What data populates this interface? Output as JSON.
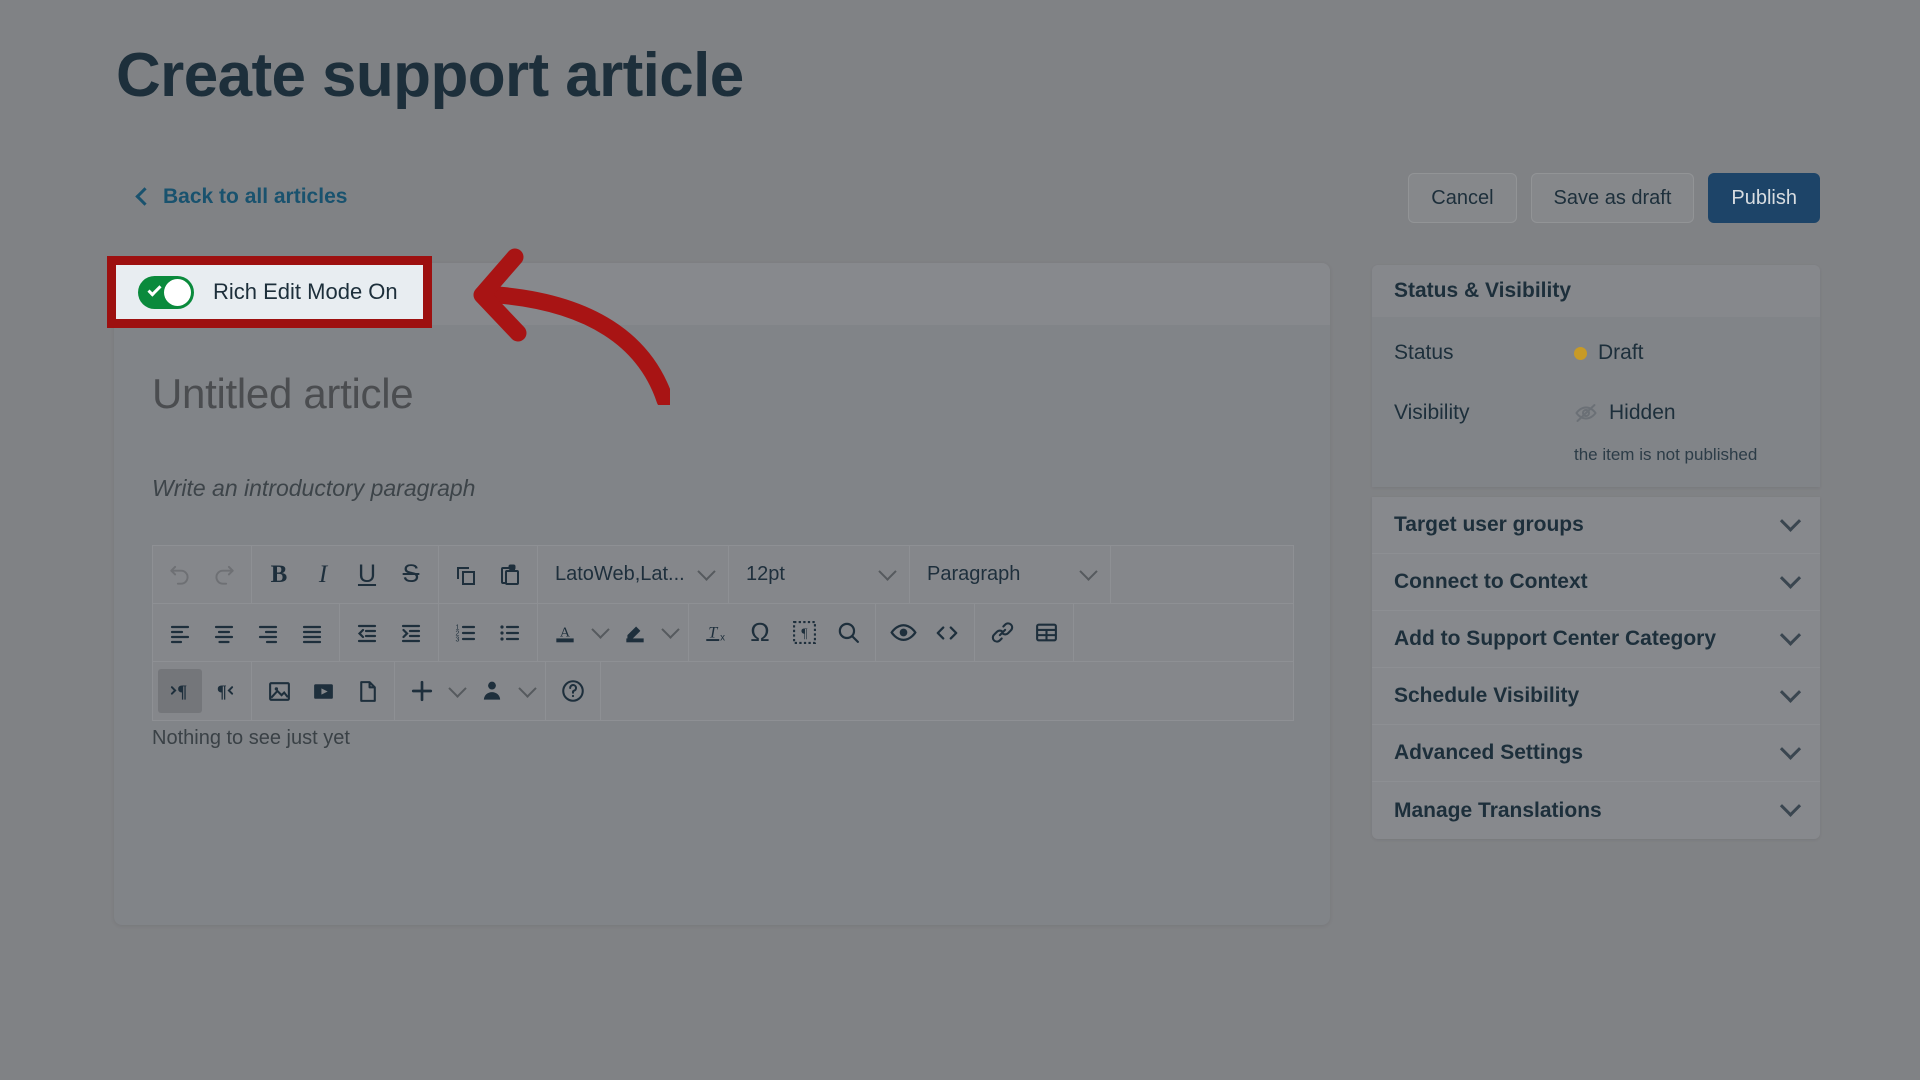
{
  "header": {
    "title": "Create support article",
    "back_link": "Back to all articles",
    "back_icon": "chevron-left-icon"
  },
  "actions": {
    "cancel": "Cancel",
    "save_draft": "Save as draft",
    "publish": "Publish",
    "publish_color": "#1d4468"
  },
  "highlight": {
    "toggle_label": "Rich Edit Mode On",
    "toggle_state": "on",
    "toggle_on_color": "#0a8a3c",
    "box_border_color": "#9d1010",
    "arrow_color": "#a81414",
    "arrow_icon": "curved-left-arrow-icon"
  },
  "editor": {
    "doc_title": "Untitled article",
    "intro_placeholder": "Write an introductory paragraph",
    "empty_state": "Nothing to see just yet",
    "selects": {
      "font_family": "LatoWeb,Lat...",
      "font_size": "12pt",
      "block_format": "Paragraph"
    },
    "toolbar_rows": [
      {
        "groups": [
          {
            "buttons": [
              {
                "name": "undo-icon",
                "title": "Undo",
                "disabled": true
              },
              {
                "name": "redo-icon",
                "title": "Redo",
                "disabled": true
              }
            ]
          },
          {
            "buttons": [
              {
                "name": "bold-icon",
                "title": "Bold"
              },
              {
                "name": "italic-icon",
                "title": "Italic"
              },
              {
                "name": "underline-icon",
                "title": "Underline"
              },
              {
                "name": "strikethrough-icon",
                "title": "Strikethrough"
              }
            ]
          },
          {
            "buttons": [
              {
                "name": "copy-icon",
                "title": "Copy"
              },
              {
                "name": "paste-icon",
                "title": "Paste"
              }
            ]
          }
        ]
      },
      {
        "groups": [
          {
            "buttons": [
              {
                "name": "align-left-icon",
                "title": "Align left"
              },
              {
                "name": "align-center-icon",
                "title": "Align center"
              },
              {
                "name": "align-right-icon",
                "title": "Align right"
              },
              {
                "name": "align-justify-icon",
                "title": "Justify"
              }
            ]
          },
          {
            "buttons": [
              {
                "name": "outdent-icon",
                "title": "Decrease indent"
              },
              {
                "name": "indent-icon",
                "title": "Increase indent"
              }
            ]
          },
          {
            "buttons": [
              {
                "name": "numbered-list-icon",
                "title": "Numbered list"
              },
              {
                "name": "bullet-list-icon",
                "title": "Bullet list"
              }
            ]
          },
          {
            "buttons": [
              {
                "name": "text-color-icon",
                "title": "Text color",
                "split": true
              },
              {
                "name": "highlight-color-icon",
                "title": "Background color",
                "split": true
              }
            ]
          },
          {
            "buttons": [
              {
                "name": "clear-formatting-icon",
                "title": "Clear formatting"
              },
              {
                "name": "special-character-icon",
                "title": "Special character"
              },
              {
                "name": "show-blocks-icon",
                "title": "Show blocks"
              },
              {
                "name": "search-icon",
                "title": "Find and replace"
              }
            ]
          },
          {
            "buttons": [
              {
                "name": "preview-icon",
                "title": "Preview"
              },
              {
                "name": "source-code-icon",
                "title": "Source code"
              }
            ]
          },
          {
            "buttons": [
              {
                "name": "link-icon",
                "title": "Insert link"
              },
              {
                "name": "table-icon",
                "title": "Table"
              }
            ]
          }
        ]
      },
      {
        "groups": [
          {
            "buttons": [
              {
                "name": "ltr-direction-icon",
                "title": "Left to right",
                "active": true
              },
              {
                "name": "rtl-direction-icon",
                "title": "Right to left"
              }
            ]
          },
          {
            "buttons": [
              {
                "name": "image-icon",
                "title": "Insert image"
              },
              {
                "name": "video-icon",
                "title": "Insert video"
              },
              {
                "name": "file-icon",
                "title": "Insert file"
              }
            ]
          },
          {
            "buttons": [
              {
                "name": "plus-icon",
                "title": "Insert",
                "split": true
              },
              {
                "name": "person-icon",
                "title": "Merge field",
                "split": true
              }
            ]
          },
          {
            "buttons": [
              {
                "name": "help-icon",
                "title": "Help"
              }
            ]
          }
        ]
      }
    ]
  },
  "sidebar": {
    "status_panel": {
      "heading": "Status & Visibility",
      "rows": [
        {
          "label": "Status",
          "value": "Draft",
          "indicator": "status-dot",
          "indicator_color": "#c79a26"
        },
        {
          "label": "Visibility",
          "value": "Hidden",
          "indicator": "eye-off-icon",
          "note": "the item is not published"
        }
      ]
    },
    "sections": [
      {
        "label": "Target user groups",
        "icon": "chevron-down-icon"
      },
      {
        "label": "Connect to Context",
        "icon": "chevron-down-icon"
      },
      {
        "label": "Add to Support Center Category",
        "icon": "chevron-down-icon"
      },
      {
        "label": "Schedule Visibility",
        "icon": "chevron-down-icon"
      },
      {
        "label": "Advanced Settings",
        "icon": "chevron-down-icon"
      },
      {
        "label": "Manage Translations",
        "icon": "chevron-down-icon"
      }
    ]
  }
}
